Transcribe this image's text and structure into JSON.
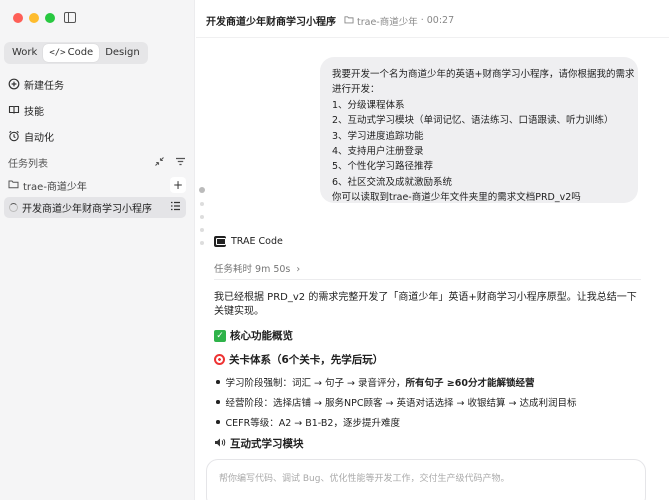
{
  "sidebar": {
    "mode_tabs": [
      {
        "label": "Work",
        "icon": ""
      },
      {
        "label": "Code",
        "icon": "</>"
      },
      {
        "label": "Design",
        "icon": ""
      }
    ],
    "nav_items": [
      {
        "label": "新建任务",
        "icon": "new-task-icon"
      },
      {
        "label": "技能",
        "icon": "book-icon"
      },
      {
        "label": "自动化",
        "icon": "alarm-clock-icon"
      }
    ],
    "task_list_title": "任务列表",
    "folder_name": "trae-商道少年",
    "task_name": "开发商道少年财商学习小程序"
  },
  "header": {
    "title": "开发商道少年财商学习小程序",
    "folder": "trae-商道少年",
    "elapsed": "00:27"
  },
  "user_message": [
    "我要开发一个名为商道少年的英语+财商学习小程序，请你根据我的需求",
    "进行开发：",
    "1、分级课程体系",
    "2、互动式学习模块（单词记忆、语法练习、口语跟读、听力训练）",
    "3、学习进度追踪功能",
    "4、支持用户注册登录",
    "5、个性化学习路径推荐",
    "6、社区交流及成就激励系统",
    "你可以读取到trae-商道少年文件夹里的需求文档PRD_v2吗"
  ],
  "agent": {
    "name": "TRAE Code",
    "elapsed_label": "任务耗时 9m 50s",
    "summary": "我已经根据 PRD_v2 的需求完整开发了「商道少年」英语+财商学习小程序原型。让我总结一下关键实现。",
    "section1": "核心功能概览",
    "section1_sub": "关卡体系（6个关卡，先学后玩）",
    "bullet1_prefix": "学习阶段强制：词汇 → 句子 → 录音评分，",
    "bullet1_bold": "所有句子 ≥60分才能解锁经营",
    "bullet2": "经营阶段：选择店铺 → 服务NPC顾客 → 英语对话选择 → 收银结算 → 达成利润目标",
    "bullet3": "CEFR等级：A2 → B1-B2，逐步提升难度",
    "section2": "互动式学习模块"
  },
  "input": {
    "placeholder": "帮你编写代码、调试 Bug、优化性能等开发工作，交付生产级代码产物。"
  }
}
